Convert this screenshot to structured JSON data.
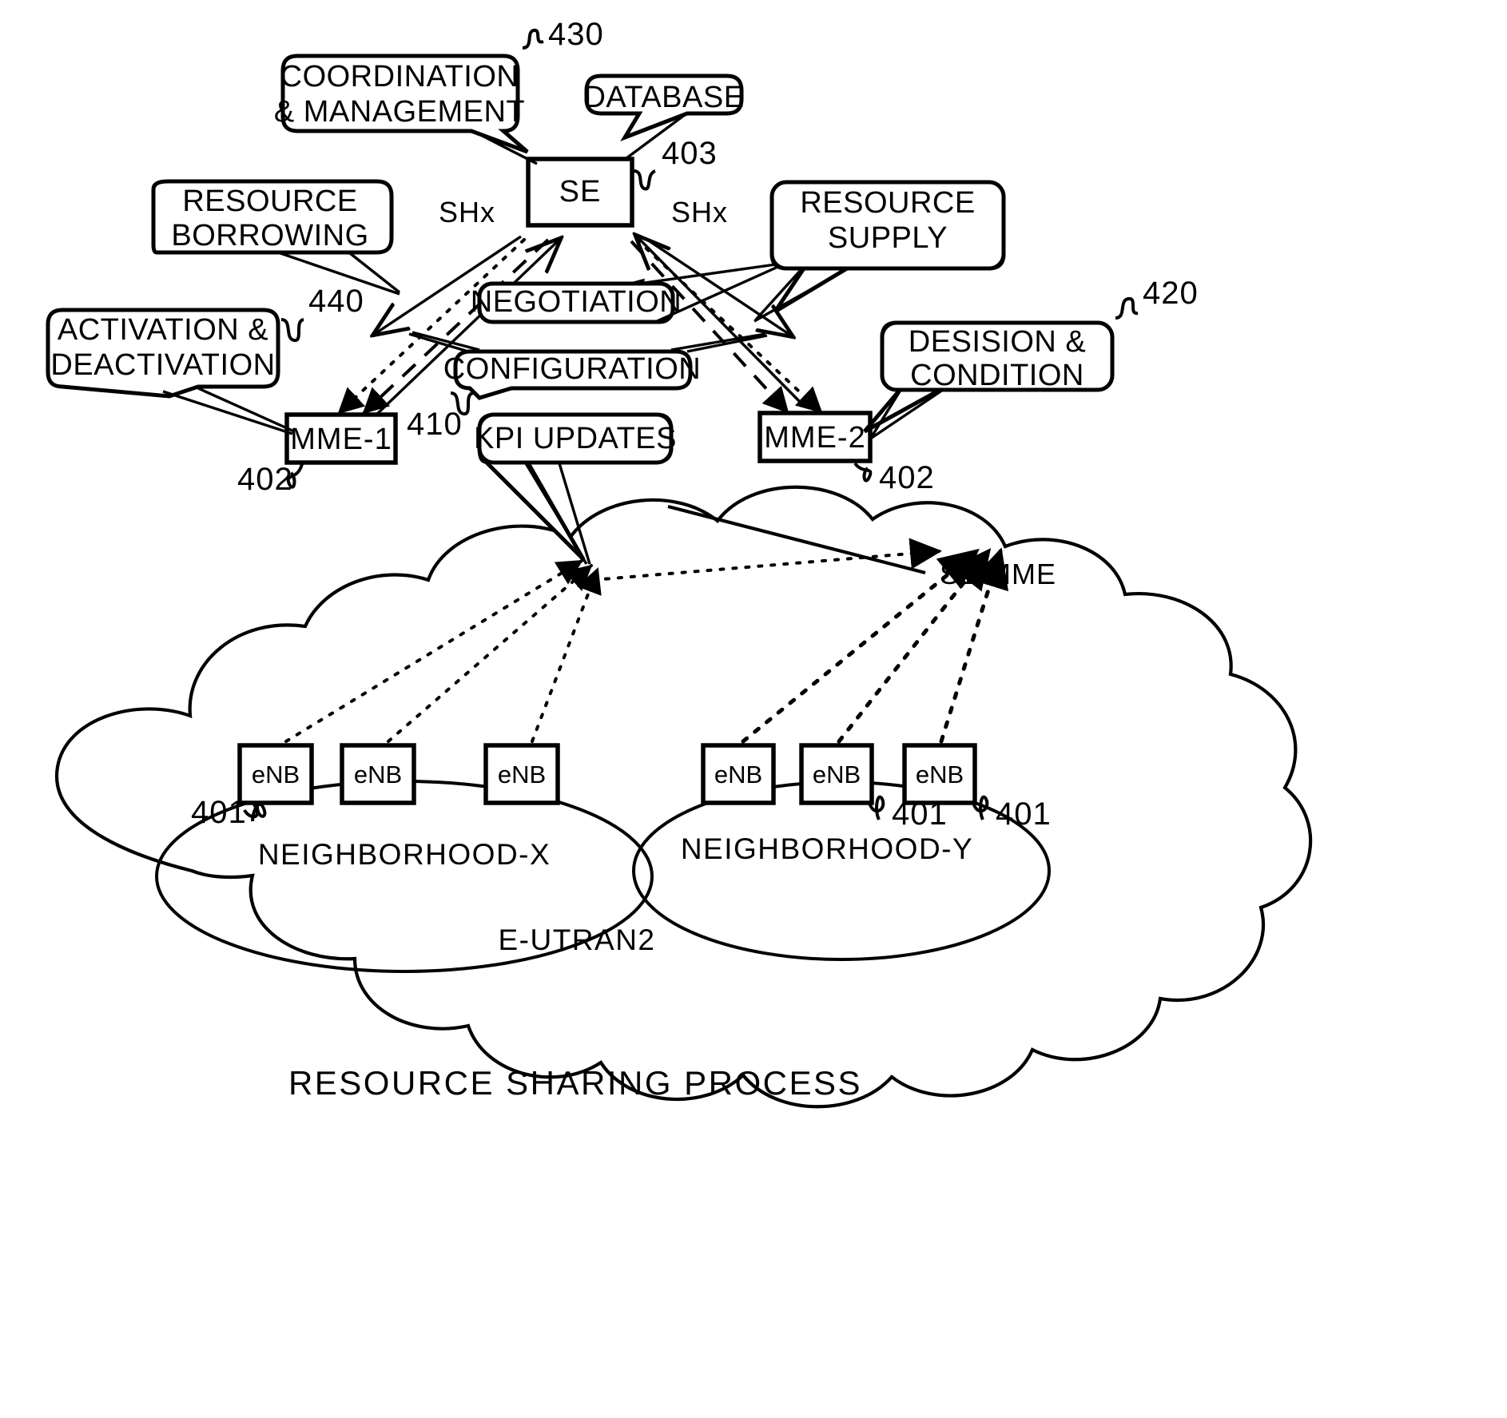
{
  "figure": {
    "title": "RESOURCE SHARING PROCESS",
    "nodes": {
      "se": "SE",
      "mme1": "MME-1",
      "mme2": "MME-2",
      "enb": "eNB"
    },
    "callouts": {
      "coordination": {
        "line1": "COORDINATION",
        "line2": "& MANAGEMENT"
      },
      "database": {
        "line1": "DATABASE"
      },
      "resource_borrowing": {
        "line1": "RESOURCE",
        "line2": "BORROWING"
      },
      "resource_supply": {
        "line1": "RESOURCE",
        "line2": "SUPPLY"
      },
      "activation": {
        "line1": "ACTIVATION  &",
        "line2": "DEACTIVATION"
      },
      "desision": {
        "line1": "DESISION  &",
        "line2": "CONDITION"
      },
      "negotiation": {
        "line1": "NEGOTIATION"
      },
      "configuration": {
        "line1": "CONFIGURATION"
      },
      "kpi_updates": {
        "line1": "KPI UPDATES"
      }
    },
    "interface_labels": {
      "shx_left": "SHx",
      "shx_right": "SHx",
      "s1_mme": "S1-MME"
    },
    "regions": {
      "neighborhood_x": "NEIGHBORHOOD-X",
      "neighborhood_y": "NEIGHBORHOOD-Y",
      "eutran": "E-UTRAN2"
    },
    "reference_numerals": {
      "n430": "430",
      "n403": "403",
      "n440": "440",
      "n420": "420",
      "n402_left": "402",
      "n402_right": "402",
      "n410": "410",
      "n401_a": "401",
      "n401_b": "401",
      "n401_c": "401"
    },
    "enb_labels": {
      "x1": "eNB",
      "x2": "eNB",
      "x3": "eNB",
      "y1": "eNB",
      "y2": "eNB",
      "y3": "eNB"
    },
    "colors": {
      "ink": "#000000",
      "paper": "#ffffff"
    }
  }
}
